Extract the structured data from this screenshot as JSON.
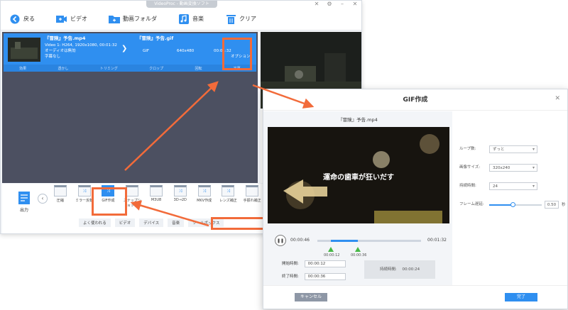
{
  "colors": {
    "accent": "#2f8ff0",
    "highlight": "#f26b3a",
    "green": "#47b846"
  },
  "main_window": {
    "title": "VideoProc - 動画変換ソフト",
    "toolbar": [
      {
        "icon": "back-icon",
        "label": "戻る"
      },
      {
        "icon": "video-add-icon",
        "label": "ビデオ"
      },
      {
        "icon": "folder-add-icon",
        "label": "動画フォルダ"
      },
      {
        "icon": "music-add-icon",
        "label": "音楽"
      },
      {
        "icon": "trash-icon",
        "label": "クリア"
      }
    ],
    "file_row": {
      "source_name": "『冒険』予告.mp4",
      "output_name": "『冒険』予告.gif",
      "source_info": "Video 1: H264, 1920x1080, 00:01:32",
      "audio_info": "オーディオは無効",
      "subtitle_info": "字幕なし",
      "format": "GIF",
      "resolution": "640x480",
      "duration": "00:01:32",
      "option_label": "オプション",
      "tools": [
        "効果",
        "透かし",
        "トリミング",
        "クロップ",
        "回転",
        "字幕"
      ]
    },
    "output_label": "出力",
    "tools": [
      {
        "label": "圧縮",
        "selected": false
      },
      {
        "label": "ミラー反転",
        "selected": false
      },
      {
        "label": "GIF作成",
        "selected": true
      },
      {
        "label": "スナップショット",
        "selected": false
      },
      {
        "label": "M3U8",
        "selected": false
      },
      {
        "label": "3D→2D",
        "selected": false
      },
      {
        "label": "MKV作成",
        "selected": false
      },
      {
        "label": "レンズ補正",
        "selected": false
      },
      {
        "label": "手振れ補正",
        "selected": false
      }
    ],
    "categories": [
      "よく使われる",
      "ビデオ",
      "デバイス",
      "音楽",
      "ツールボックス"
    ]
  },
  "dialog": {
    "title": "GIF作成",
    "file_name": "『冒険』予告.mp4",
    "subtitle": "運命の歯車が狂いだす",
    "time_current": "00:00:46",
    "time_total": "00:01:32",
    "clip_start_label": "00:00:12",
    "clip_end_label": "00:00:36",
    "clip_start_frac": 0.13,
    "clip_end_frac": 0.39,
    "start_time_label": "開始時間:",
    "start_time": "00:00:12",
    "end_time_label": "終了時間:",
    "end_time": "00:00:36",
    "duration_label": "持続時間:",
    "duration": "00:00:24",
    "params": [
      {
        "label": "ループ数:",
        "value": "ずっと"
      },
      {
        "label": "画像サイズ:",
        "value": "320x240"
      },
      {
        "label": "持続時間:",
        "value": "24"
      }
    ],
    "frame_delay_label": "フレーム遅延:",
    "frame_delay": "0.50",
    "frame_delay_frac": 0.45,
    "frame_delay_unit": "秒",
    "cancel": "キャンセル",
    "done": "完了"
  }
}
